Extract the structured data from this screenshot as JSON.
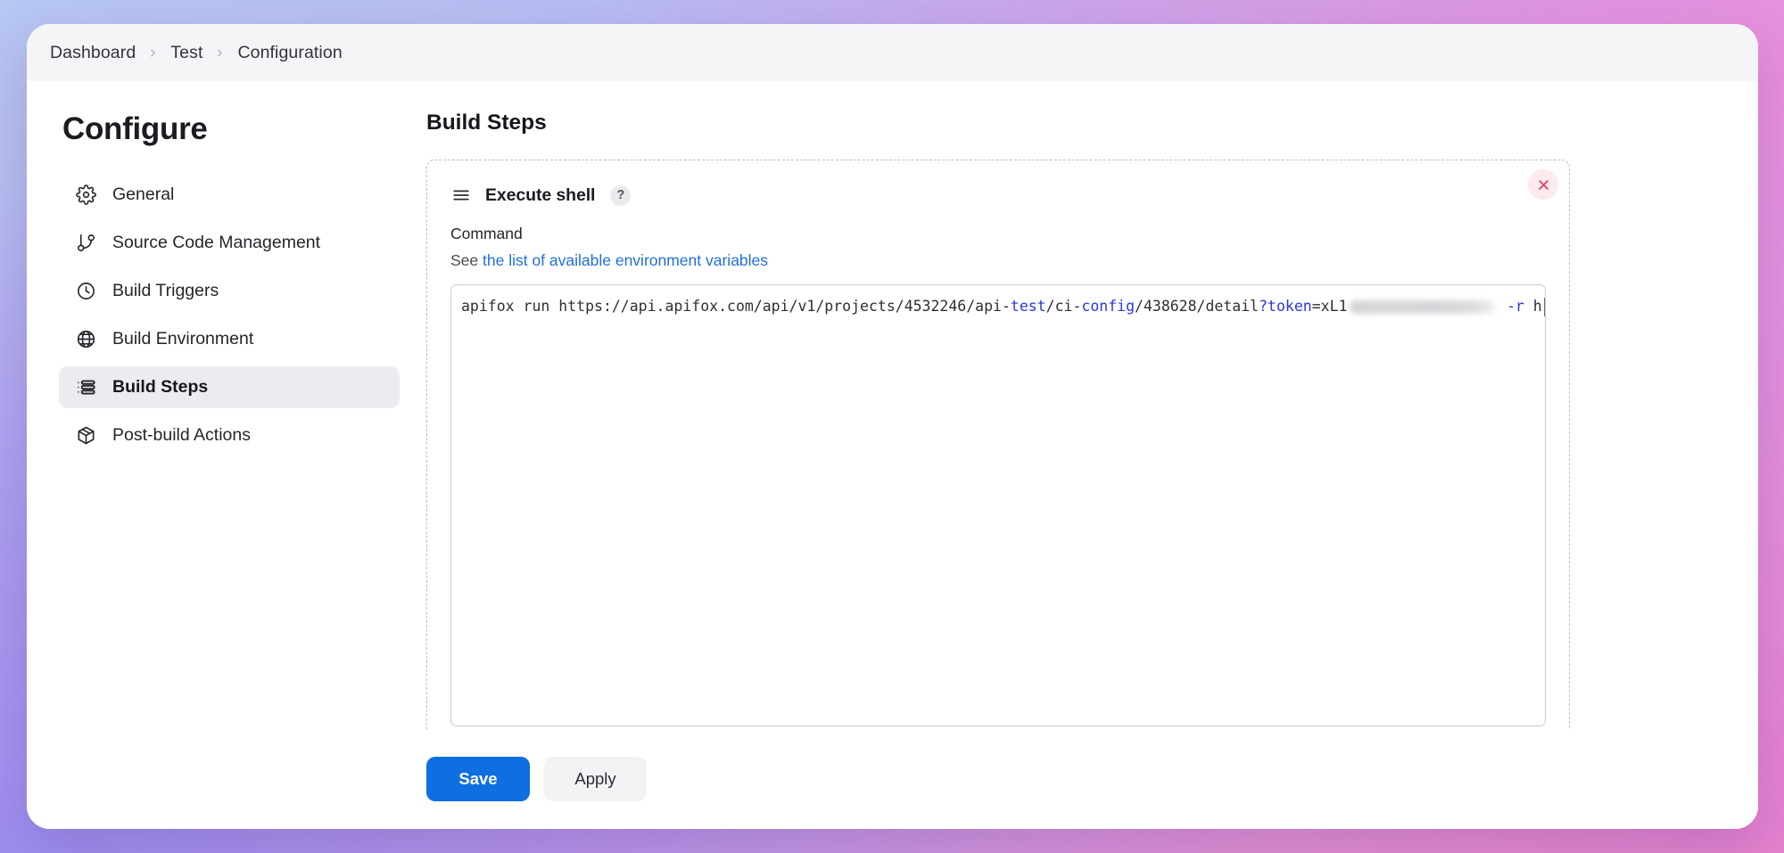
{
  "breadcrumb": {
    "items": [
      "Dashboard",
      "Test",
      "Configuration"
    ],
    "separator_icon": "chevron-right-icon"
  },
  "sidebar": {
    "title": "Configure",
    "items": [
      {
        "label": "General",
        "icon": "gear-icon",
        "selected": false
      },
      {
        "label": "Source Code Management",
        "icon": "git-branch-icon",
        "selected": false
      },
      {
        "label": "Build Triggers",
        "icon": "clock-icon",
        "selected": false
      },
      {
        "label": "Build Environment",
        "icon": "globe-icon",
        "selected": false
      },
      {
        "label": "Build Steps",
        "icon": "list-icon",
        "selected": true
      },
      {
        "label": "Post-build Actions",
        "icon": "package-icon",
        "selected": false
      }
    ]
  },
  "main": {
    "title": "Build Steps",
    "step": {
      "drag_icon": "hamburger-drag-icon",
      "title": "Execute shell",
      "help_badge": "?",
      "close_icon": "close-icon",
      "command_label": "Command",
      "help_prefix": "See ",
      "help_link": "the list of available environment variables",
      "command": {
        "segments": [
          {
            "text": "apifox run https://api.apifox.com/api/v1/projects/4532246/api-",
            "style": "plain"
          },
          {
            "text": "test",
            "style": "keyword"
          },
          {
            "text": "/ci-",
            "style": "plain"
          },
          {
            "text": "config",
            "style": "keyword"
          },
          {
            "text": "/438628/detail",
            "style": "plain"
          },
          {
            "text": "?token",
            "style": "keyword"
          },
          {
            "text": "=xL1",
            "style": "plain"
          },
          {
            "text": "",
            "style": "redacted"
          },
          {
            "text": " ",
            "style": "plain"
          },
          {
            "text": "-r",
            "style": "keyword"
          },
          {
            "text": " h",
            "style": "plain"
          }
        ],
        "plain_text": "apifox run https://api.apifox.com/api/v1/projects/4532246/api-test/ci-config/438628/detail?token=xL1████████ -r h"
      }
    }
  },
  "footer": {
    "save_label": "Save",
    "apply_label": "Apply"
  },
  "colors": {
    "accent": "#0f6fe0",
    "link": "#1f6fd8",
    "danger": "#e8415e",
    "selected_bg": "#ebecf0",
    "code_keyword": "#2a36e0",
    "breadcrumb_bg": "#f5f5f7"
  }
}
